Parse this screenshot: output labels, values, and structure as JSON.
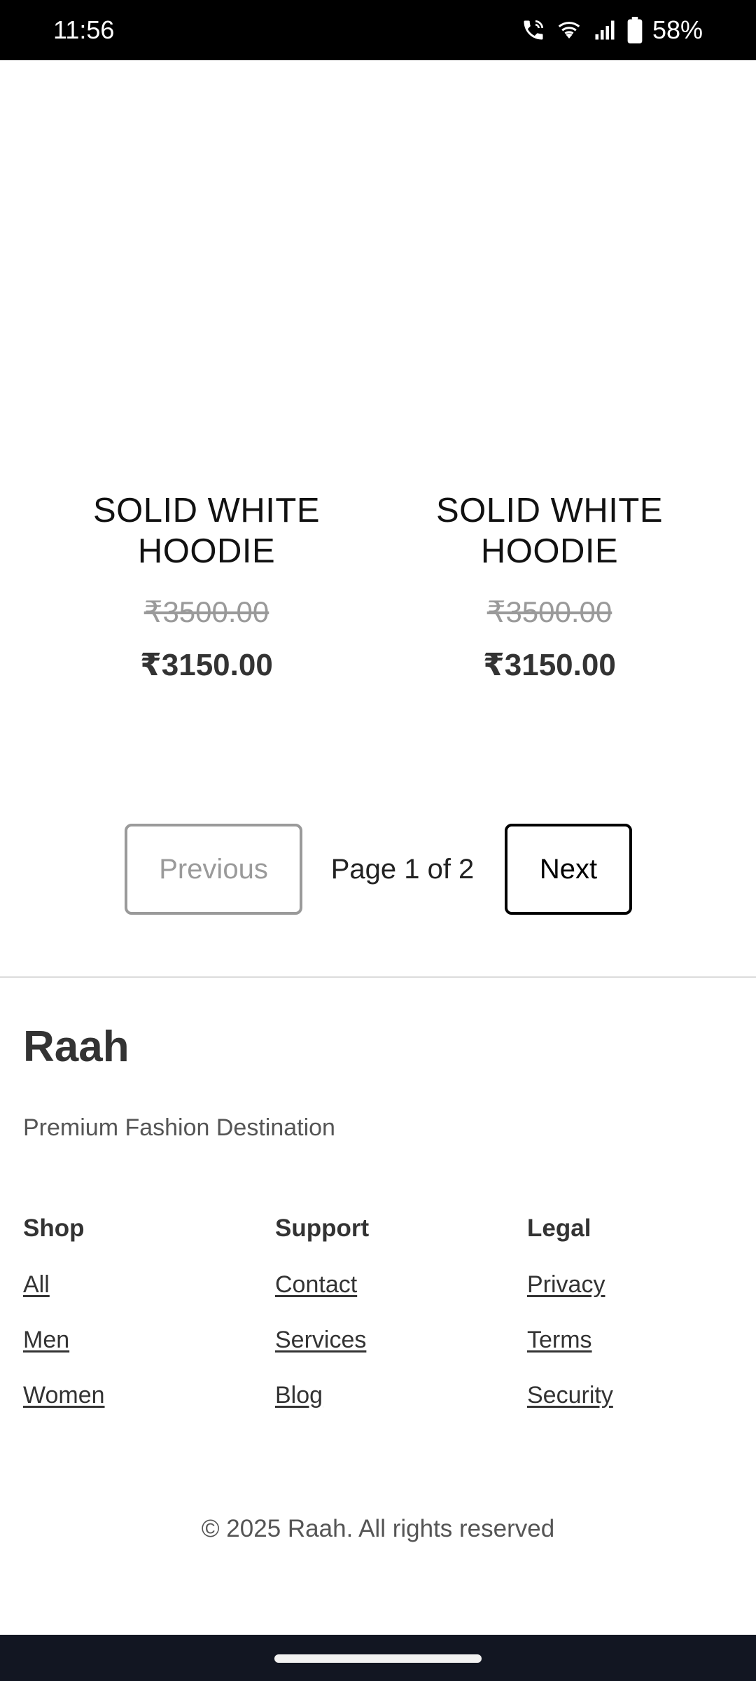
{
  "status_bar": {
    "time": "11:56",
    "battery": "58%",
    "icons": [
      "wifi-call-icon",
      "wifi-icon",
      "signal-icon",
      "battery-icon"
    ]
  },
  "products": [
    {
      "name": "SOLID WHITE HOODIE",
      "old_price": "₹3500.00",
      "price": "₹3150.00"
    },
    {
      "name": "SOLID WHITE HOODIE",
      "old_price": "₹3500.00",
      "price": "₹3150.00"
    }
  ],
  "pagination": {
    "previous_label": "Previous",
    "page_label": "Page 1 of 2",
    "next_label": "Next"
  },
  "footer": {
    "brand": "Raah",
    "tagline": "Premium Fashion Destination",
    "columns": [
      {
        "title": "Shop",
        "links": [
          "All",
          "Men",
          "Women"
        ]
      },
      {
        "title": "Support",
        "links": [
          "Contact",
          "Services",
          "Blog"
        ]
      },
      {
        "title": "Legal",
        "links": [
          "Privacy",
          "Terms",
          "Security"
        ]
      }
    ],
    "copyright": "© 2025 Raah. All rights reserved"
  },
  "colors": {
    "status_bar_bg": "#000000",
    "nav_bar_bg": "#121622",
    "disabled_gray": "#9a9a9a",
    "text_dark": "#333333"
  }
}
